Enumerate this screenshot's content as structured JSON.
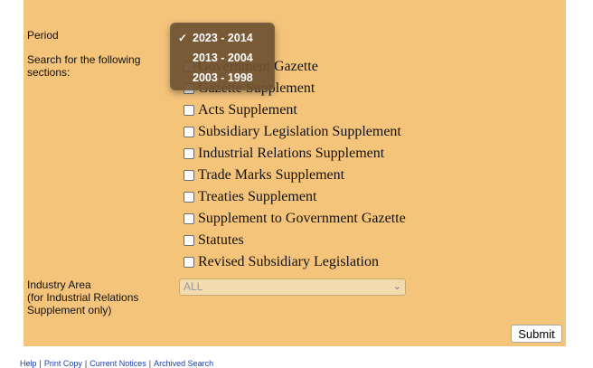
{
  "form": {
    "period_label": "Period",
    "sections_label": "Search for the following sections:",
    "industry_label_lines": [
      "Industry Area",
      "(for Industrial Relations",
      "Supplement only)"
    ],
    "sections": [
      {
        "label": "Government Gazette",
        "checked": false
      },
      {
        "label": "Gazette Supplement",
        "checked": false
      },
      {
        "label": "Acts Supplement",
        "checked": false
      },
      {
        "label": "Subsidiary Legislation Supplement",
        "checked": false
      },
      {
        "label": "Industrial Relations Supplement",
        "checked": false
      },
      {
        "label": "Trade Marks Supplement",
        "checked": false
      },
      {
        "label": "Treaties Supplement",
        "checked": false
      },
      {
        "label": "Supplement to Government Gazette",
        "checked": false
      },
      {
        "label": "Statutes",
        "checked": false
      },
      {
        "label": "Revised Subsidiary Legislation",
        "checked": false
      }
    ],
    "industry_select_value": "ALL",
    "submit_label": "Submit"
  },
  "period_dropdown": {
    "options": [
      "2023 - 2014",
      "2013 - 2004",
      "2003 - 1998"
    ],
    "selected_index": 0,
    "check_glyph": "✓"
  },
  "footer": {
    "links": [
      "Help",
      "Print Copy",
      "Current Notices",
      "Archived Search"
    ],
    "separator": "|"
  },
  "colors": {
    "panel": "#f5c47b",
    "dropdown_bg": "#6e5230",
    "link": "#1a3fb0"
  }
}
